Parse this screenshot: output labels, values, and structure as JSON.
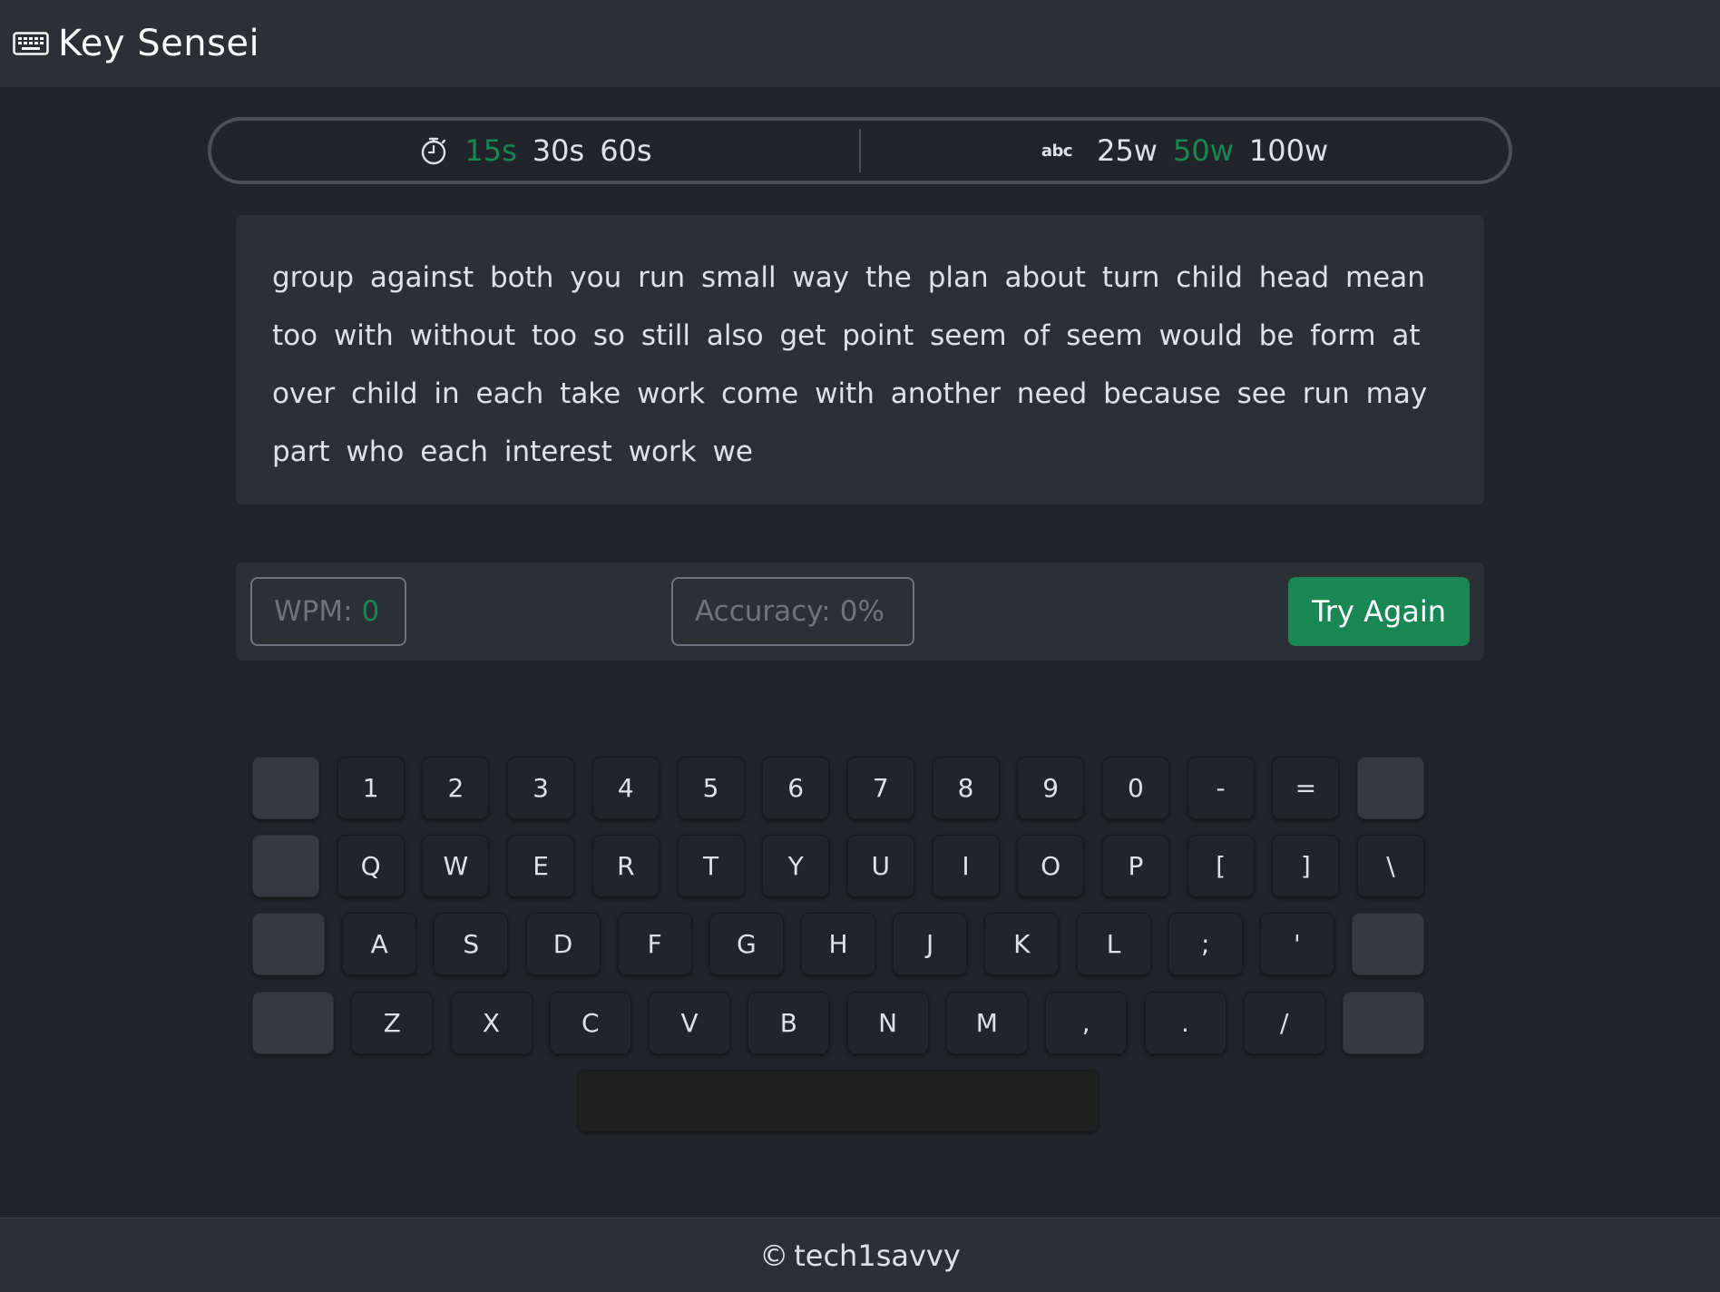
{
  "app": {
    "title": "Key Sensei",
    "icon": "keyboard-icon"
  },
  "modes": {
    "time": {
      "icon": "stopwatch-icon",
      "options": [
        "15s",
        "30s",
        "60s"
      ],
      "selected": "15s"
    },
    "words": {
      "icon_label": "abc",
      "options": [
        "25w",
        "50w",
        "100w"
      ],
      "selected": "50w"
    }
  },
  "passage": {
    "lines": [
      "group against both you run small way the plan about turn child head mean",
      "too with without too so still also get point seem of seem would be form at",
      "over child in each take work come with another need because see run may",
      "part who each interest work we"
    ]
  },
  "stats": {
    "wpm_label": "WPM:",
    "wpm_value": "0",
    "accuracy_label": "Accuracy:",
    "accuracy_value": "0%",
    "try_again_label": "Try Again"
  },
  "keyboard": {
    "rows": [
      [
        "",
        "1",
        "2",
        "3",
        "4",
        "5",
        "6",
        "7",
        "8",
        "9",
        "0",
        "-",
        "=",
        ""
      ],
      [
        "",
        "Q",
        "W",
        "E",
        "R",
        "T",
        "Y",
        "U",
        "I",
        "O",
        "P",
        "[",
        "]",
        "\\"
      ],
      [
        "",
        "A",
        "S",
        "D",
        "F",
        "G",
        "H",
        "J",
        "K",
        "L",
        ";",
        "'",
        ""
      ],
      [
        "",
        "Z",
        "X",
        "C",
        "V",
        "B",
        "N",
        "M",
        ",",
        ".",
        "/",
        ""
      ],
      [
        ""
      ]
    ]
  },
  "footer": {
    "symbol": "©",
    "text": "tech1savvy"
  },
  "colors": {
    "accent": "#198754",
    "background": "#212529",
    "panel": "#2b3035",
    "muted": "#6c757d"
  }
}
